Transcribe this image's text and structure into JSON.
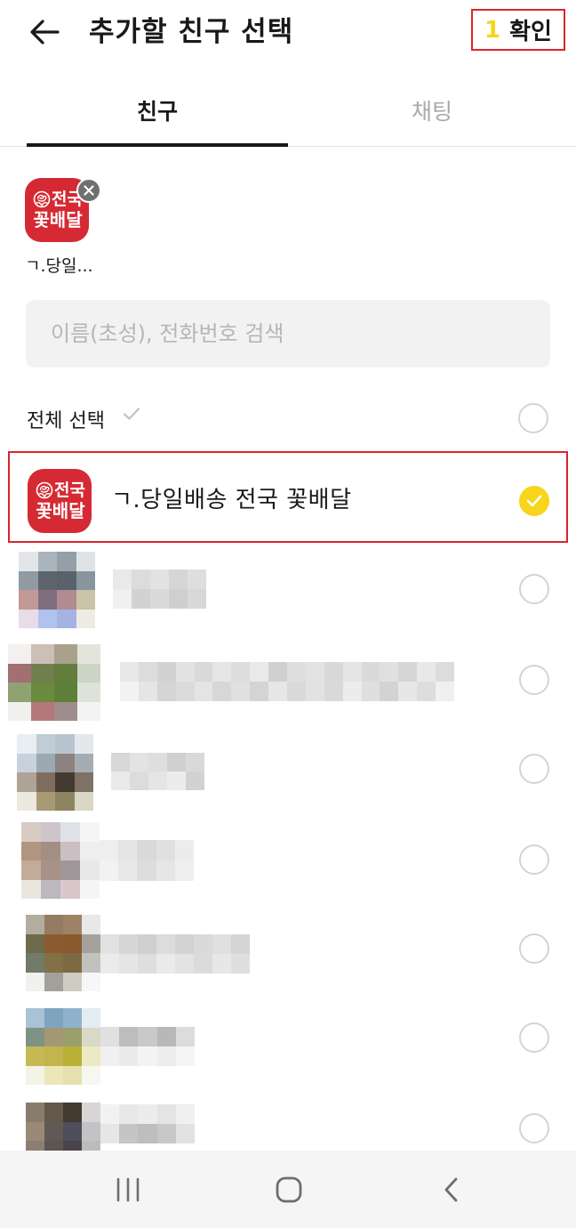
{
  "header": {
    "title": "추가할 친구 선택",
    "confirm_count": "1",
    "confirm_label": "확인"
  },
  "icons": {
    "back": "arrow-left-icon",
    "remove": "close-icon",
    "check": "check-icon",
    "nav_recent": "recent-apps-icon",
    "nav_home": "home-icon",
    "nav_back": "back-chevron-icon"
  },
  "tabs": [
    {
      "label": "친구",
      "active": true
    },
    {
      "label": "채팅",
      "active": false
    }
  ],
  "selected_chips": [
    {
      "name": "ㄱ.당일...",
      "logo_line1": "전국",
      "logo_line2": "꽃배달"
    }
  ],
  "search": {
    "placeholder": "이름(초성), 전화번호 검색"
  },
  "select_all": {
    "label": "전체 선택"
  },
  "friends_selected": [
    {
      "name": "ㄱ.당일배송 전국 꽃배달",
      "checked": true
    }
  ],
  "colors": {
    "accent": "#f7d51d",
    "highlight_border": "#d9262b",
    "logo_bg": "#d52a33",
    "tab_inactive": "#a9a9a9",
    "text": "#191919"
  }
}
